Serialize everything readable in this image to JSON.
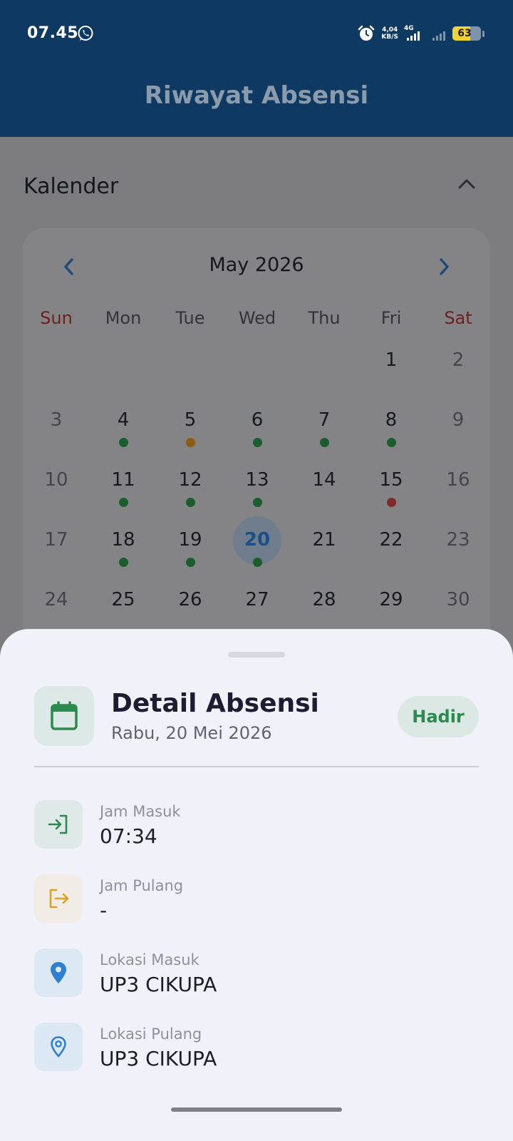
{
  "status_bar": {
    "time": "07.45",
    "net_speed_value": "4,04",
    "net_speed_unit": "KB/S",
    "network_type": "4G",
    "battery": "63"
  },
  "app_bar": {
    "title": "Riwayat Absensi"
  },
  "calendar": {
    "section_title": "Kalender",
    "month_label": "May 2026",
    "weekdays": [
      "Sun",
      "Mon",
      "Tue",
      "Wed",
      "Thu",
      "Fri",
      "Sat"
    ],
    "weeks": [
      [
        "",
        "",
        "",
        "",
        "",
        "1",
        "2"
      ],
      [
        "3",
        "4",
        "5",
        "6",
        "7",
        "8",
        "9"
      ],
      [
        "10",
        "11",
        "12",
        "13",
        "14",
        "15",
        "16"
      ],
      [
        "17",
        "18",
        "19",
        "20",
        "21",
        "22",
        "23"
      ],
      [
        "24",
        "25",
        "26",
        "27",
        "28",
        "29",
        "30"
      ]
    ],
    "markers": {
      "4": "green",
      "5": "orange",
      "6": "green",
      "7": "green",
      "8": "green",
      "11": "green",
      "12": "green",
      "13": "green",
      "15": "red",
      "18": "green",
      "19": "green",
      "20": "green"
    },
    "selected_day": "20"
  },
  "detail": {
    "title": "Detail Absensi",
    "date": "Rabu, 20 Mei 2026",
    "status": "Hadir",
    "items": [
      {
        "label": "Jam Masuk",
        "value": "07:34",
        "icon": "login-icon",
        "tone": "green"
      },
      {
        "label": "Jam Pulang",
        "value": "-",
        "icon": "logout-icon",
        "tone": "orange"
      },
      {
        "label": "Lokasi Masuk",
        "value": "UP3 CIKUPA",
        "icon": "location-filled-icon",
        "tone": "blue"
      },
      {
        "label": "Lokasi Pulang",
        "value": "UP3 CIKUPA",
        "icon": "location-outline-icon",
        "tone": "blue"
      }
    ]
  },
  "colors": {
    "app_bar": "#0d3962",
    "present": "#2d8a4e",
    "late": "#e0a020",
    "absent": "#c03a3a",
    "location": "#2f7fd0"
  }
}
